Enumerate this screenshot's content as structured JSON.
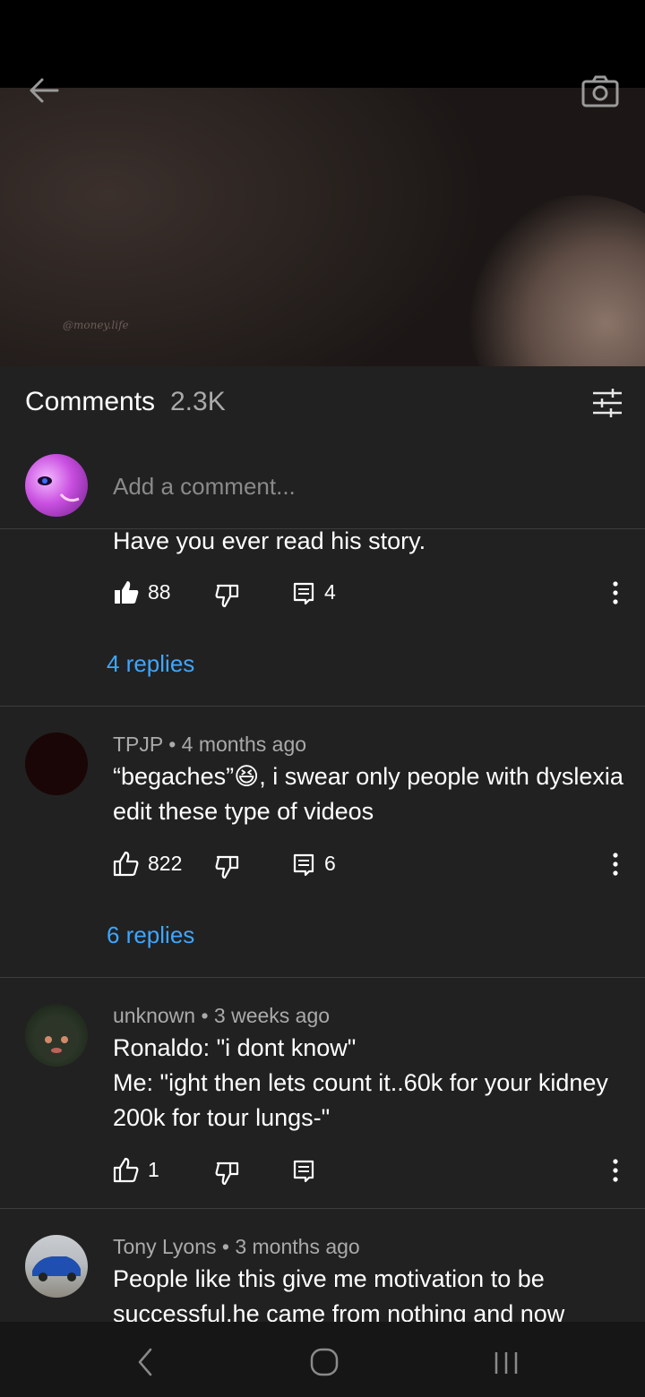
{
  "video": {
    "watermark": "@money.life"
  },
  "header": {
    "title": "Comments",
    "count": "2.3K"
  },
  "add_comment": {
    "placeholder": "Add a comment..."
  },
  "comments": [
    {
      "text": "Have you ever read his story.",
      "likes": "88",
      "replies_count": "4",
      "replies_link": "4 replies"
    },
    {
      "author": "TPJP",
      "time": "4 months ago",
      "text_line1": "“begaches”😆, i swear only people with dyslexia",
      "text_line2": "edit these type of videos",
      "likes": "822",
      "replies_count": "6",
      "replies_link": "6 replies"
    },
    {
      "author": "unknown",
      "time": "3 weeks ago",
      "text_line1": "Ronaldo: \"i dont know\"",
      "text_line2": "Me: \"ight then lets count it..60k for your kidney",
      "text_line3": "200k for tour lungs-\"",
      "likes": "1"
    },
    {
      "author": "Tony Lyons",
      "time": "3 months ago",
      "text_line1": "People like this give me motivation to be",
      "text_line2": "successful.he came from nothing and now"
    }
  ],
  "colors": {
    "link": "#3ea6ff",
    "background": "#212121",
    "secondary_text": "#aaaaaa"
  },
  "icons": [
    "back-arrow-icon",
    "camera-icon",
    "filter-icon",
    "thumbs-up-icon",
    "thumbs-down-icon",
    "reply-icon",
    "more-vert-icon",
    "nav-back-icon",
    "nav-home-icon",
    "nav-recents-icon"
  ]
}
